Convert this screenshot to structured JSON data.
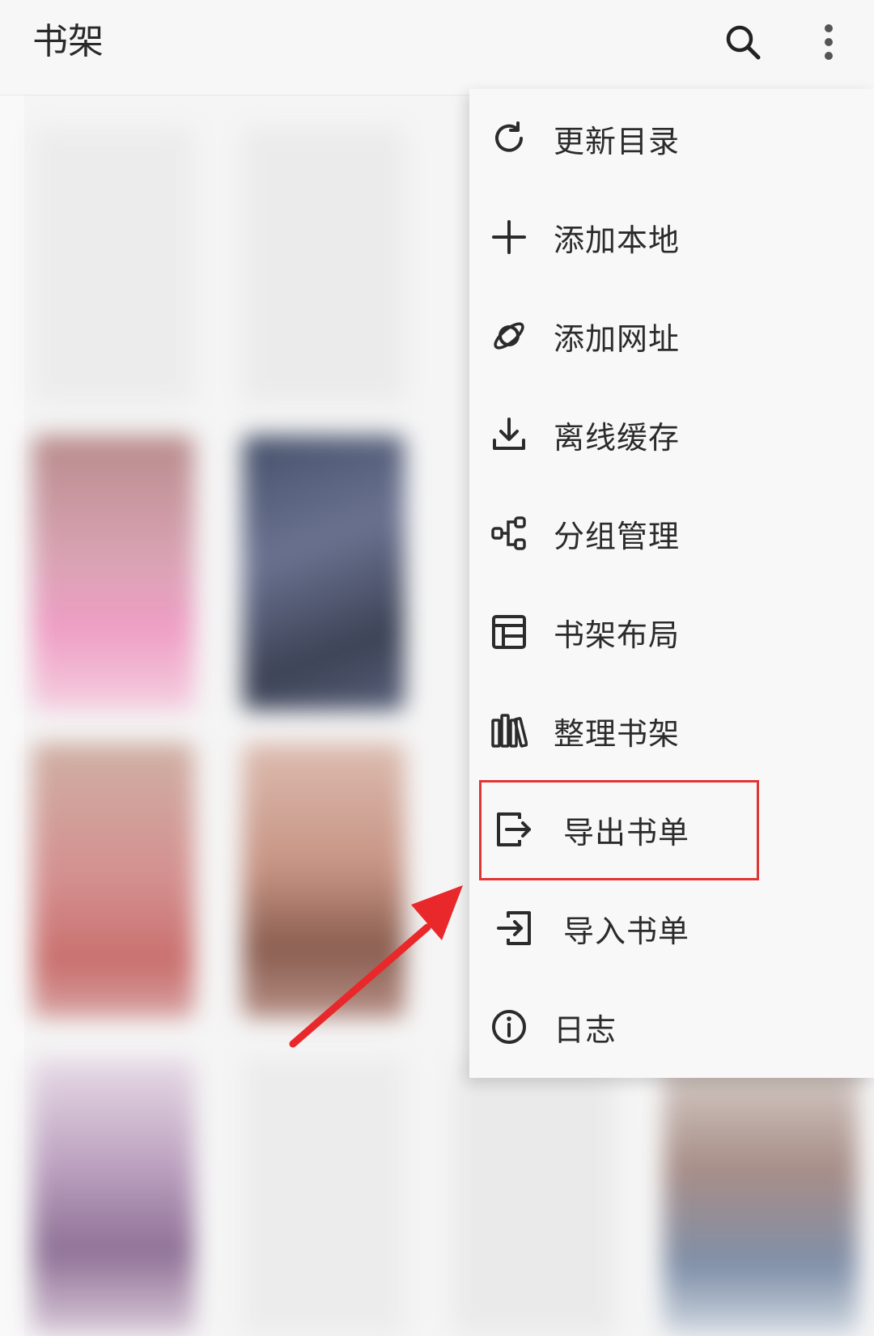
{
  "header": {
    "title": "书架",
    "search_icon": "search-icon",
    "more_icon": "more-vertical-icon"
  },
  "menu": {
    "items": [
      {
        "label": "更新目录",
        "icon": "refresh-icon"
      },
      {
        "label": "添加本地",
        "icon": "plus-icon"
      },
      {
        "label": "添加网址",
        "icon": "planet-icon"
      },
      {
        "label": "离线缓存",
        "icon": "download-icon"
      },
      {
        "label": "分组管理",
        "icon": "group-icon"
      },
      {
        "label": "书架布局",
        "icon": "layout-icon"
      },
      {
        "label": "整理书架",
        "icon": "books-icon"
      },
      {
        "label": "导出书单",
        "icon": "export-icon",
        "highlighted": true
      },
      {
        "label": "导入书单",
        "icon": "import-icon"
      },
      {
        "label": "日志",
        "icon": "info-icon"
      }
    ]
  },
  "colors": {
    "highlight": "#e03535",
    "arrow": "#e8282b",
    "menu_background": "#f8f8f8",
    "icon": "#2b2b2b"
  }
}
